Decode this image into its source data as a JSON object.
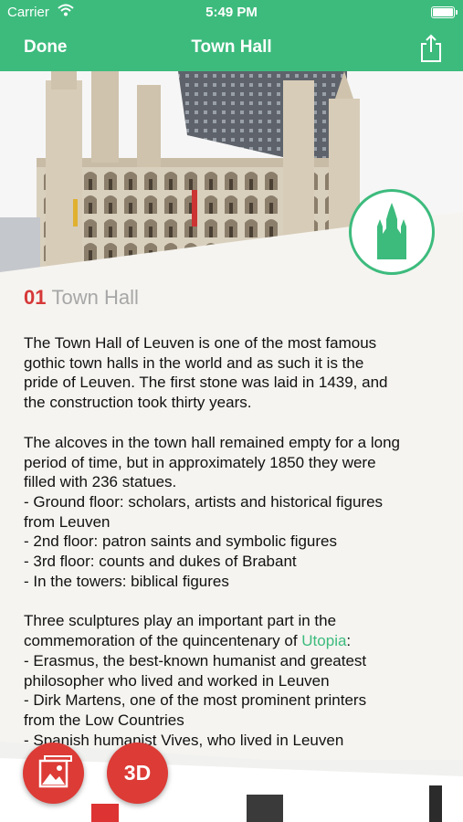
{
  "status_bar": {
    "carrier": "Carrier",
    "time": "5:49 PM"
  },
  "nav": {
    "done_label": "Done",
    "title": "Town Hall"
  },
  "detail": {
    "number": "01",
    "heading": "Town Hall",
    "p1": [
      "The Town Hall of Leuven is one of the most famous",
      "gothic town halls in the world and as such it is the",
      "pride of Leuven. The first stone was laid in 1439, and",
      "the construction took thirty years."
    ],
    "p2": [
      "The alcoves in the town hall remained empty for a long",
      "period of time, but in approximately 1850 they were",
      "filled with 236 statues.",
      " - Ground floor: scholars, artists and historical figures",
      "from Leuven",
      " - 2nd floor: patron saints and symbolic figures",
      " - 3rd floor: counts and dukes of Brabant",
      " - In the towers: biblical figures"
    ],
    "p3_intro": "Three sculptures play an important part in the",
    "p3_line2_pre": "commemoration of the quincentenary of ",
    "p3_link": "Utopia",
    "p3_line2_post": ":",
    "p3_rest": [
      "- Erasmus, the best-known humanist and greatest",
      "philosopher who lived and worked in Leuven",
      "- Dirk Martens, one of the most prominent printers",
      "from the Low Countries",
      "- Spanish humanist Vives, who lived in Leuven"
    ]
  },
  "fab": {
    "threed_label": "3D"
  },
  "icons": {
    "wifi": "wifi-icon",
    "battery": "battery-icon",
    "share": "share-icon",
    "badge": "town-hall-icon",
    "gallery": "gallery-icon"
  },
  "colors": {
    "accent": "#3dbb7d",
    "number": "#d63838",
    "fab": "#dc3b36",
    "heading_gray": "#a7a7a7"
  }
}
